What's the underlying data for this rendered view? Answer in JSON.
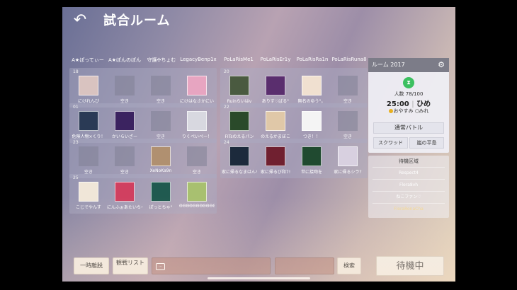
{
  "header": {
    "back_icon": "back-arrow-icon",
    "title": "試合ルーム"
  },
  "teams_left": [
    "A★ぽってぃー",
    "A★ぽんのぽん",
    "守護✣ちょむ",
    "LegacyBenp1x"
  ],
  "teams_right": [
    "PoLaRisMe1",
    "PoLaRisEr1y",
    "PoLaRisRa1n",
    "PoLaRisRuna8"
  ],
  "rooms": [
    {
      "num": "18",
      "slots": [
        {
          "name": "にけれんび",
          "color": "#d9c3c0"
        },
        {
          "name": "空き",
          "empty": true
        },
        {
          "name": "空き",
          "empty": true
        },
        {
          "name": "にけはなさかにい",
          "color": "#e7a5c1"
        }
      ]
    },
    {
      "num": "20",
      "slots": [
        {
          "name": "Ruinらいはv",
          "color": "#4a5a40"
        },
        {
          "name": "ありす♡ばる°",
          "color": "#5a2e6e"
        },
        {
          "name": "無名のゆう°。",
          "color": "#f0e0d0"
        },
        {
          "name": "空き",
          "empty": true
        }
      ]
    },
    {
      "num": "01",
      "slots": [
        {
          "name": "危険人物×くり！",
          "color": "#2a3a55"
        },
        {
          "name": "かいらいざー",
          "color": "#3b2360"
        },
        {
          "name": "空き",
          "empty": true
        },
        {
          "name": "りくぺいぺー！",
          "color": "#d8d8e0"
        }
      ]
    },
    {
      "num": "22",
      "slots": [
        {
          "name": "FITsのえるパン",
          "color": "#2a4a2a"
        },
        {
          "name": "のえるかまぼこ",
          "color": "#e0c8a8"
        },
        {
          "name": "つき！！",
          "color": "#f4f4f4"
        },
        {
          "name": "空き",
          "empty": true
        }
      ]
    },
    {
      "num": "23",
      "slots": [
        {
          "name": "空き",
          "empty": true
        },
        {
          "name": "空き",
          "empty": true
        },
        {
          "name": "XeNoKa9n",
          "color": "#b09070"
        },
        {
          "name": "空き",
          "empty": true
        }
      ]
    },
    {
      "num": "24",
      "slots": [
        {
          "name": "家に帰るなまはんち",
          "color": "#1c2a3c"
        },
        {
          "name": "家に帰るび和7!",
          "color": "#702030"
        },
        {
          "name": "世に接吻を",
          "color": "#204a30"
        },
        {
          "name": "家に帰るシラ?",
          "color": "#d8d0e0"
        }
      ]
    },
    {
      "num": "25",
      "slots": [
        {
          "name": "こじでやんす",
          "color": "#f0e6d8"
        },
        {
          "name": "にんふぉあたいちゃ",
          "color": "#d04060"
        },
        {
          "name": "ぽっとちゃ°",
          "color": "#205a50"
        },
        {
          "name": "ΘΘΘΘΘΘΘΘΘΘΘ",
          "color": "#a8c070"
        }
      ]
    }
  ],
  "room_panel": {
    "title": "ルーム 2017",
    "gear_icon": "gear-icon",
    "hourglass_icon": "hourglass-icon",
    "count": "人数 78/100",
    "time": "25:00",
    "separator": "|",
    "host": "ひめ",
    "option1": "おやすみ",
    "option2": "みれ",
    "mode": "通常バトル",
    "squad": "スクワッド",
    "map": "嵐の平島"
  },
  "wait_panel": {
    "title": "待機区域",
    "items": [
      "Respect4",
      "Flora8vh",
      "ねこファン♡",
      "FloraRonaCha"
    ]
  },
  "bottom": {
    "leave": "一時離脱",
    "watch": "観戦リスト",
    "chat_icon": "chat-icon",
    "search": "検索",
    "ready": "待機中"
  }
}
